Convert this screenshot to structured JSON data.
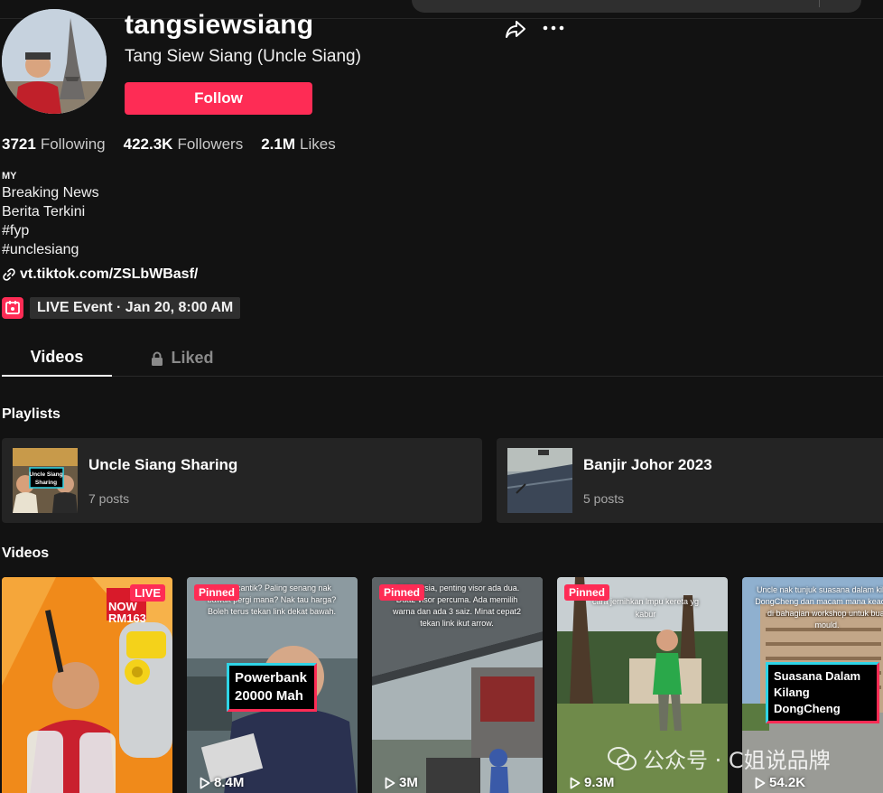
{
  "profile": {
    "username": "tangsiewsiang",
    "display_name": "Tang Siew Siang (Uncle Siang)",
    "follow_label": "Follow"
  },
  "stats": [
    {
      "value": "3721",
      "label": "Following"
    },
    {
      "value": "422.3K",
      "label": "Followers"
    },
    {
      "value": "2.1M",
      "label": "Likes"
    }
  ],
  "bio": {
    "country": "MY",
    "lines": [
      "Breaking News",
      "Berita Terkini",
      "#fyp",
      "#unclesiang"
    ],
    "link": "vt.tiktok.com/ZSLbWBasf/"
  },
  "live_event": "LIVE Event · Jan 20, 8:00 AM",
  "tabs": {
    "videos": "Videos",
    "liked": "Liked"
  },
  "sections": {
    "playlists": "Playlists",
    "videos": "Videos"
  },
  "playlists": [
    {
      "name": "Uncle Siang Sharing",
      "count": "7 posts",
      "thumb_caption": "Uncle Siang Sharing"
    },
    {
      "name": "Banjir Johor 2023",
      "count": "5 posts"
    }
  ],
  "videos": [
    {
      "badge": "LIVE",
      "views": "",
      "overlay": "NOW RM163"
    },
    {
      "badge": "Pinned",
      "views": "8.4M",
      "caption": "Powerbank 20000 Mah"
    },
    {
      "badge": "Pinned",
      "views": "3M"
    },
    {
      "badge": "Pinned",
      "views": "9.3M",
      "overlay": "cara jernihkan lmpu kereta yg kabur"
    },
    {
      "badge": "",
      "views": "54.2K",
      "caption": "Suasana Dalam Kilang DongCheng"
    }
  ],
  "watermark": "公众号 · C姐说品牌",
  "colors": {
    "accent": "#fe2c55",
    "background": "#121212",
    "cyan": "#2fd4e6"
  },
  "icons": [
    "share-icon",
    "more-icon",
    "link-icon",
    "calendar-icon",
    "lock-icon",
    "play-icon"
  ]
}
